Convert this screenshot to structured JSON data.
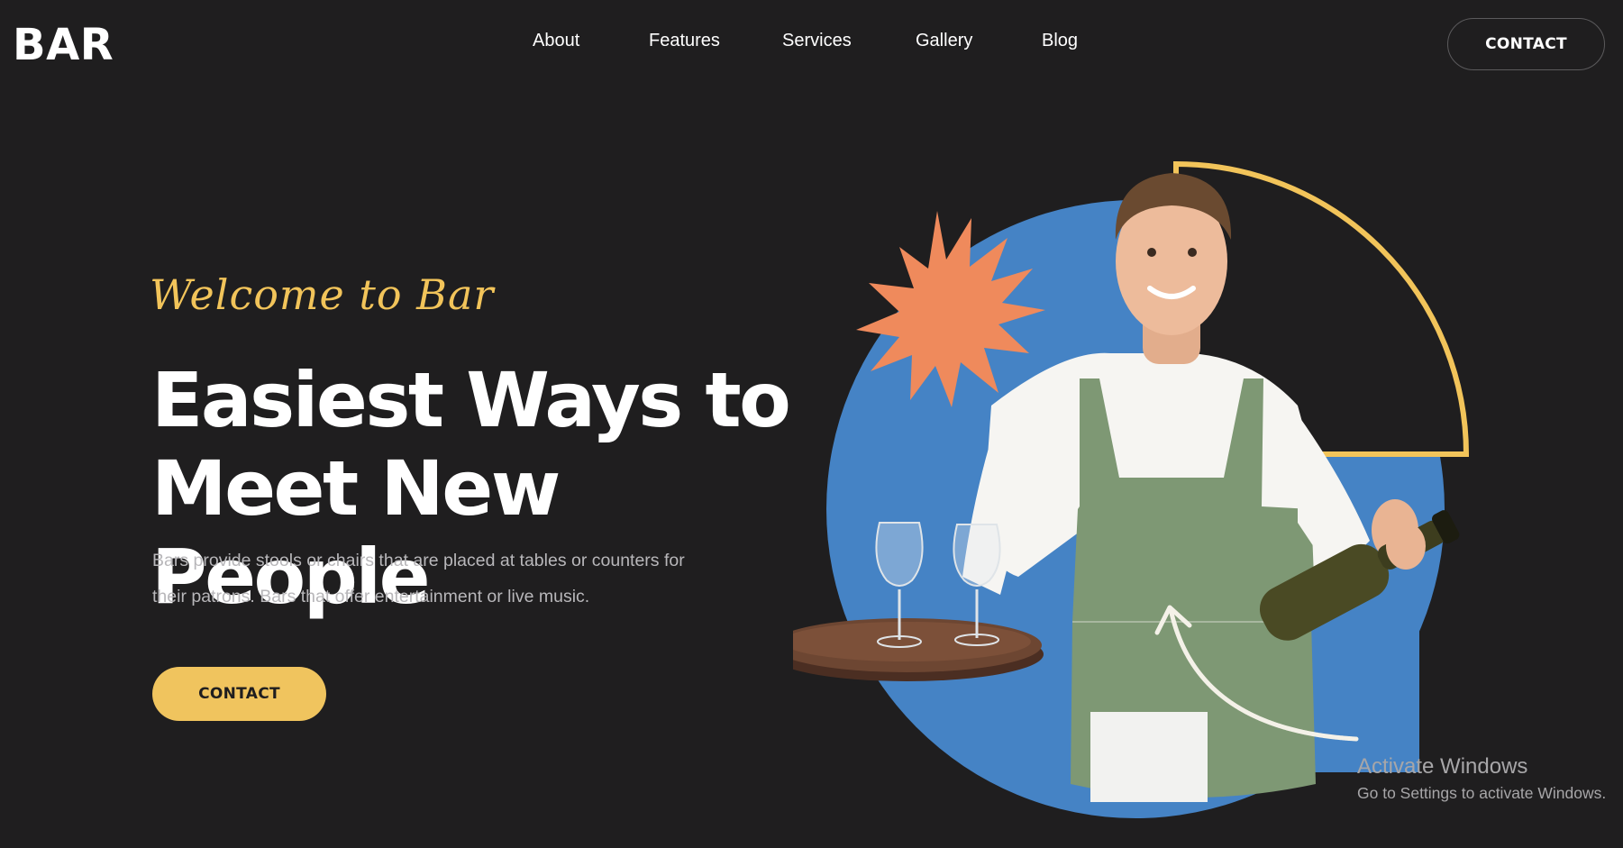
{
  "header": {
    "logo": "BAR",
    "nav": [
      "About",
      "Features",
      "Services",
      "Gallery",
      "Blog"
    ],
    "contact_label": "CONTACT"
  },
  "hero": {
    "welcome": "Welcome to Bar",
    "headline_line1": "Easiest Ways to",
    "headline_line2": "Meet New People",
    "description_line1": "Bars provide stools or chairs that are placed at tables or counters for",
    "description_line2": "their patrons. Bars that offer entertainment or live music.",
    "contact_label": "CONTACT"
  },
  "watermark": {
    "title": "Activate Windows",
    "subtitle": "Go to Settings to activate Windows."
  },
  "colors": {
    "background": "#1f1e1f",
    "accent_yellow": "#f0c45e",
    "circle_blue": "#4583c5",
    "star_orange": "#ef8a5c",
    "apron_green": "#7e9874"
  },
  "icons": {
    "burst": "starburst-shape",
    "arrow": "curved-arrow"
  }
}
